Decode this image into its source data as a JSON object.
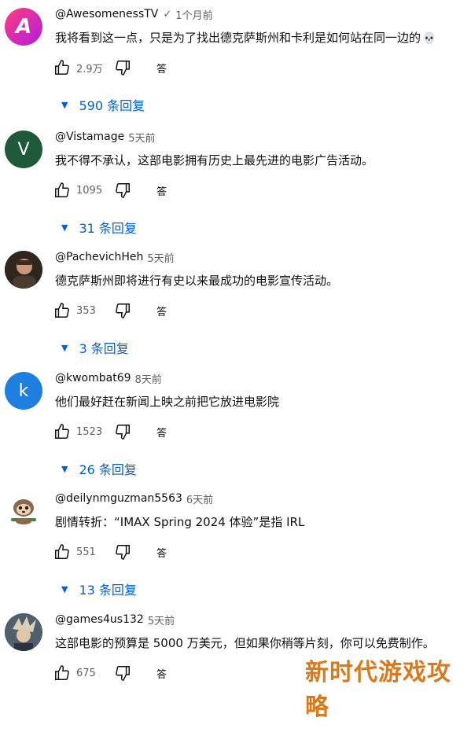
{
  "comments": [
    {
      "author": "@AwesomenessTV",
      "verified": "✓",
      "time": "1个月前",
      "text": "我将看到这一点，只是为了找出德克萨斯州和卡利是如何站在同一边的",
      "emoji": "💀",
      "likes": "2.9万",
      "reply_label": "答",
      "replies": "590 条回复",
      "avatar_text": "A"
    },
    {
      "author": "@Vistamage",
      "time": "5天前",
      "text": "我不得不承认，这部电影拥有历史上最先进的电影广告活动。",
      "likes": "1095",
      "reply_label": "答",
      "replies": "31 条回复",
      "avatar_text": "V"
    },
    {
      "author": "@PachevichHeh",
      "time": "5天前",
      "text": "德克萨斯州即将进行有史以来最成功的电影宣传活动。",
      "likes": "353",
      "reply_label": "答",
      "replies": "3 条回复"
    },
    {
      "author": "@kwombat69",
      "time": "8天前",
      "text": "他们最好赶在新闻上映之前把它放进电影院",
      "likes": "1523",
      "reply_label": "答",
      "replies": "26 条回复",
      "avatar_text": "k"
    },
    {
      "author": "@deilynmguzman5563",
      "time": "6天前",
      "text": "剧情转折：“IMAX Spring 2024 体验”是指 IRL",
      "likes": "551",
      "reply_label": "答",
      "replies": "13 条回复"
    },
    {
      "author": "@games4us132",
      "time": "5天前",
      "text": "这部电影的预算是 5000 万美元，但如果你稍等片刻，你可以免费制作。",
      "likes": "675",
      "reply_label": "答"
    }
  ],
  "colors": {
    "link_blue": "#065fd4",
    "secondary_text": "#606060",
    "watermark": "#d97a1e"
  },
  "icons": [
    "like-icon",
    "dislike-icon",
    "expand-triangle-icon",
    "verified-check-icon"
  ],
  "watermark": "新时代游戏攻略"
}
